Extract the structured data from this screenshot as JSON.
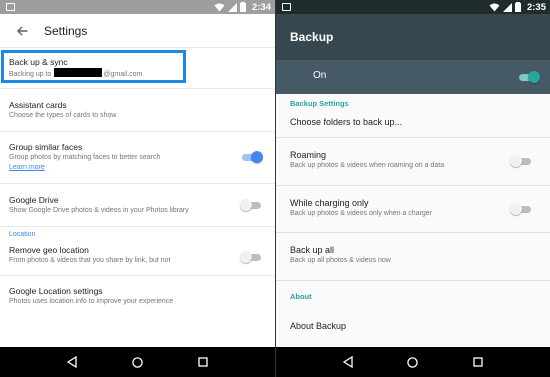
{
  "left": {
    "status_time": "2:34",
    "title": "Settings",
    "items": [
      {
        "title": "Back up & sync",
        "subtitle_prefix": "Backing up to",
        "subtitle_suffix": "@gmail.com"
      },
      {
        "title": "Assistant cards",
        "subtitle": "Choose the types of cards to show"
      },
      {
        "title": "Group similar faces",
        "subtitle": "Group photos by matching faces to better search",
        "link": "Learn more",
        "toggle_on": true
      },
      {
        "title": "Google Drive",
        "subtitle": "Show Google Drive photos & videos in your Photos library",
        "toggle_on": false
      },
      {
        "title": "Remove geo location",
        "subtitle": "From photos & videos that you share by link, but not",
        "toggle_on": false
      },
      {
        "title": "Google Location settings",
        "subtitle": "Photos uses location info to improve your experience"
      }
    ],
    "section_location": "Location",
    "accent_color": "#4285f4",
    "highlight_color": "#1e88e5"
  },
  "right": {
    "status_time": "2:35",
    "title": "Backup",
    "master_label": "On",
    "master_on": true,
    "section_settings": "Backup Settings",
    "choose_folders": "Choose folders to back up...",
    "roaming": {
      "title": "Roaming",
      "subtitle": "Back up photos & videos when roaming on a data",
      "on": false
    },
    "charging": {
      "title": "While charging only",
      "subtitle": "Back up photos & videos only when a charger",
      "on": false
    },
    "backup_all": {
      "title": "Back up all",
      "subtitle": "Back up all photos & videos now"
    },
    "section_about": "About",
    "about_backup": "About Backup",
    "header_color": "#37474f",
    "accent_color": "#26a69a"
  },
  "nav_icons": [
    "back-icon",
    "home-icon",
    "recents-icon"
  ]
}
